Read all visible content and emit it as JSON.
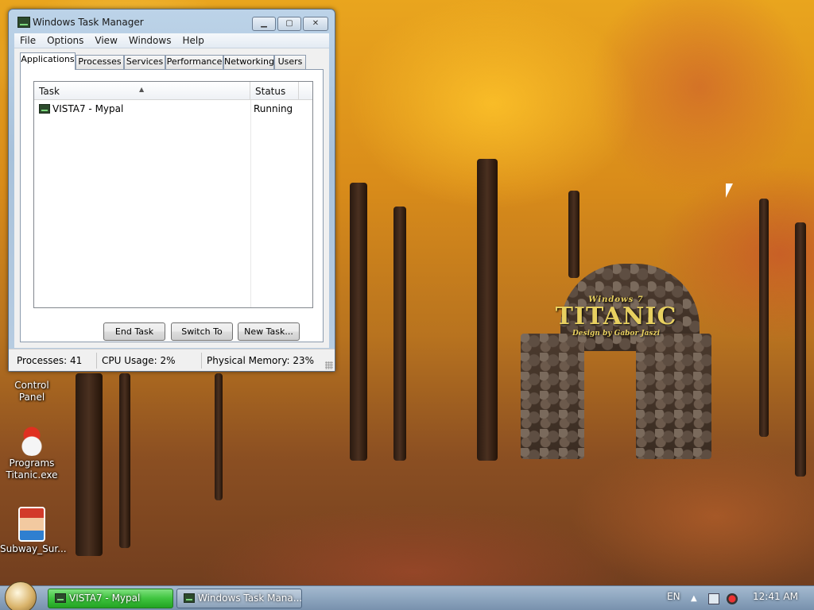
{
  "window": {
    "title": "Windows Task Manager",
    "controls": {
      "minimize": "▁",
      "maximize": "▢",
      "close": "✕"
    }
  },
  "menu": [
    "File",
    "Options",
    "View",
    "Windows",
    "Help"
  ],
  "tabs": [
    {
      "label": "Applications",
      "active": true
    },
    {
      "label": "Processes"
    },
    {
      "label": "Services"
    },
    {
      "label": "Performance"
    },
    {
      "label": "Networking"
    },
    {
      "label": "Users"
    }
  ],
  "task_list": {
    "columns": [
      "Task",
      "Status"
    ],
    "rows": [
      {
        "task": "VISTA7 - Mypal",
        "status": "Running"
      }
    ]
  },
  "buttons": {
    "end_task": "End Task",
    "switch_to": "Switch To",
    "new_task": "New Task..."
  },
  "statusbar": {
    "processes": "Processes: 41",
    "cpu": "CPU Usage: 2%",
    "memory": "Physical Memory: 23%"
  },
  "desktop": {
    "icons": [
      {
        "label": "Control Panel",
        "icon": "control-panel-icon"
      },
      {
        "label_line1": "Programs",
        "label_line2": "Titanic.exe",
        "icon": "titanic-icon"
      },
      {
        "label": "Subway_Sur...",
        "icon": "subway-surfers-icon"
      }
    ],
    "wallpaper_logo": {
      "small": "Windows 7",
      "big": "TITANIC",
      "sub": "Design by Gabor Jaszi"
    }
  },
  "taskbar": {
    "buttons": [
      {
        "label": "VISTA7 - Mypal",
        "active": true
      },
      {
        "label": "Windows Task Mana...",
        "active": false
      }
    ],
    "language": "EN",
    "clock": "12:41 AM",
    "accent_color": "#3fc43f"
  }
}
